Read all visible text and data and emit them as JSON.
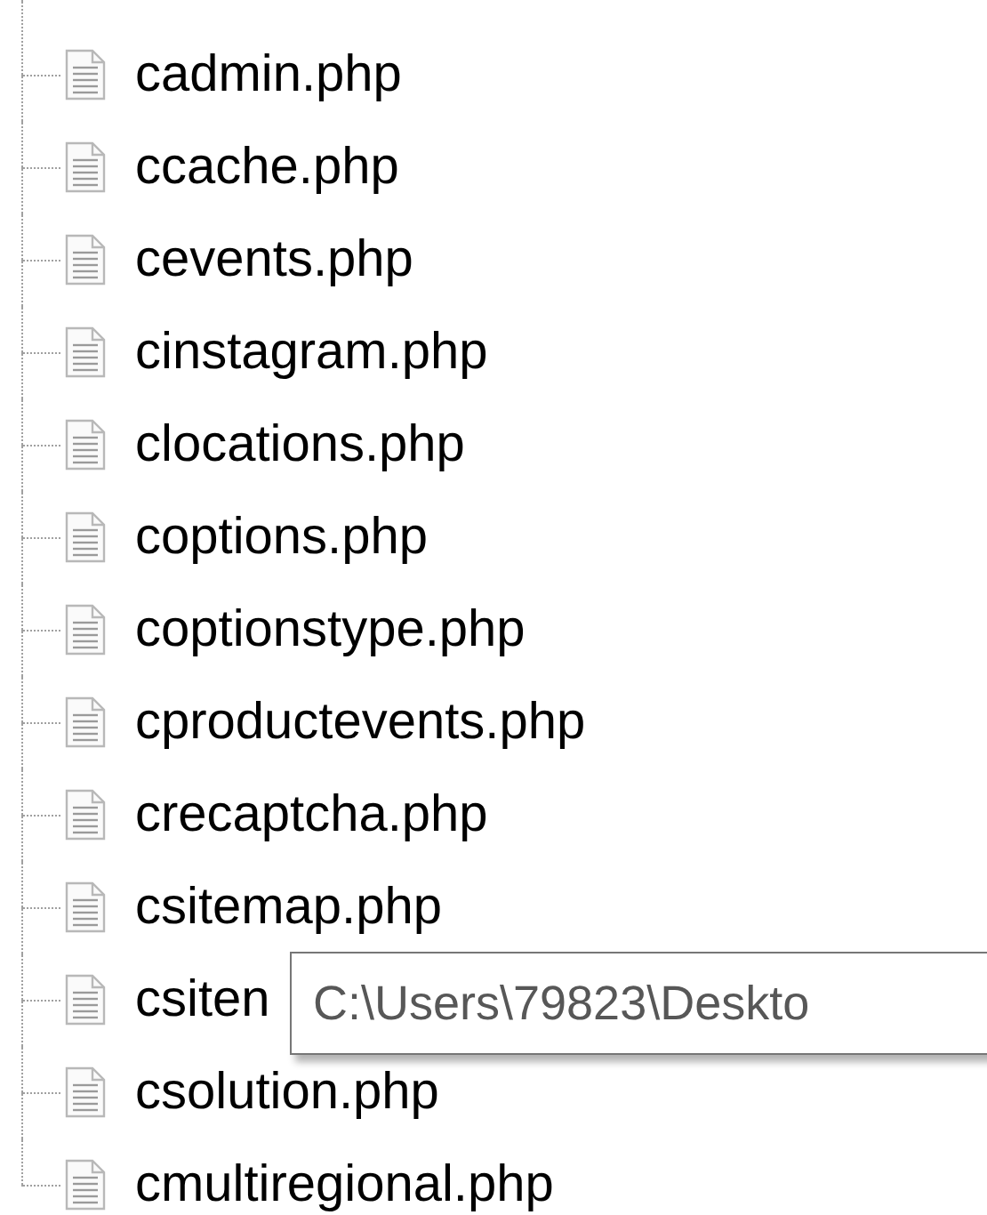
{
  "tree": {
    "items": [
      {
        "label": "cadmin.php"
      },
      {
        "label": "ccache.php"
      },
      {
        "label": "cevents.php"
      },
      {
        "label": "cinstagram.php"
      },
      {
        "label": "clocations.php"
      },
      {
        "label": "coptions.php"
      },
      {
        "label": "coptionstype.php"
      },
      {
        "label": "cproductevents.php"
      },
      {
        "label": "crecaptcha.php"
      },
      {
        "label": "csitemap.php"
      },
      {
        "label": "csiten"
      },
      {
        "label": "csolution.php"
      },
      {
        "label": "cmultiregional.php"
      }
    ]
  },
  "tooltip": {
    "text": "C:\\Users\\79823\\Deskto"
  }
}
